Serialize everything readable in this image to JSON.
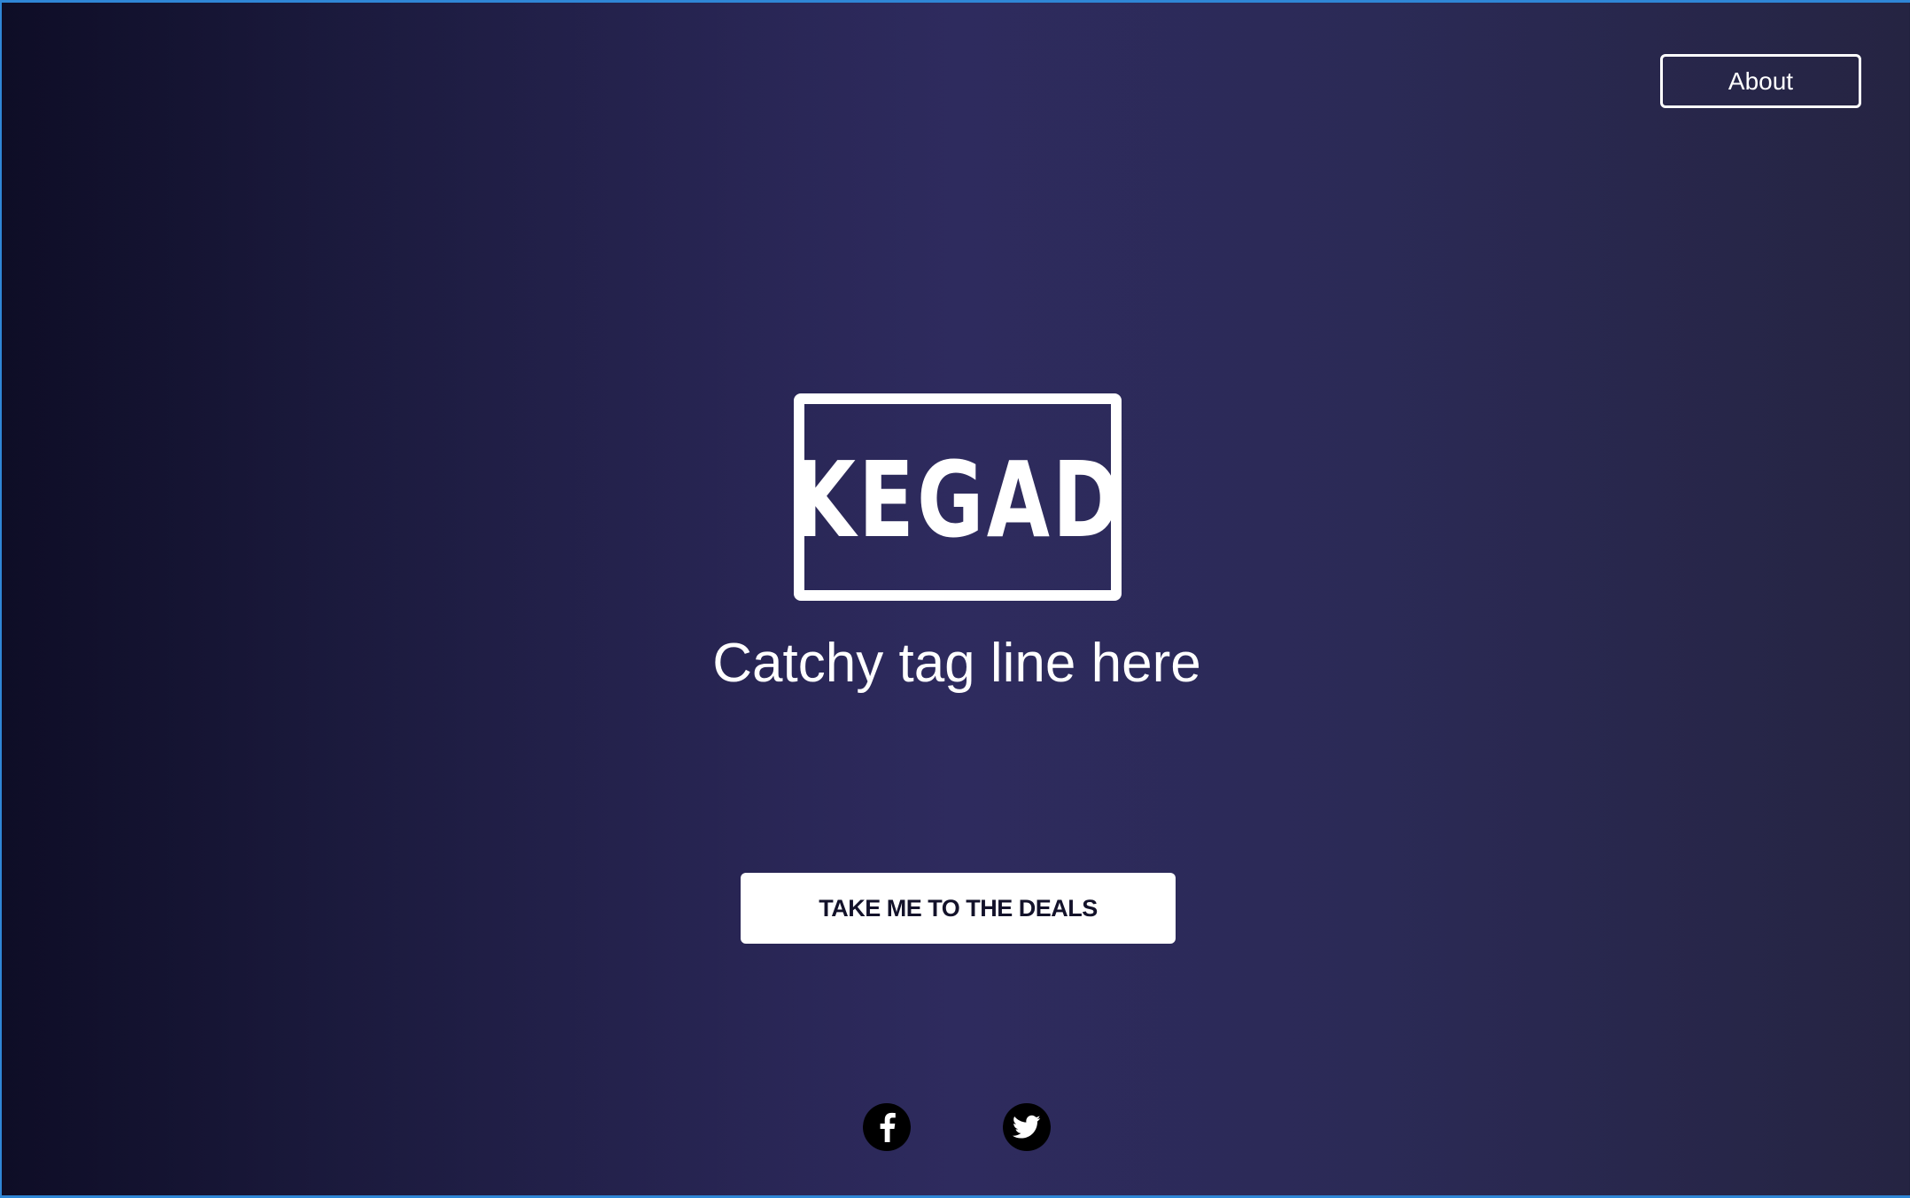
{
  "nav": {
    "about_label": "About"
  },
  "hero": {
    "logo_text": "KEGAD",
    "tagline": "Catchy tag line here",
    "cta_label": "TAKE ME TO THE DEALS"
  },
  "social": {
    "icons": [
      "facebook-icon",
      "twitter-icon"
    ]
  },
  "colors": {
    "accent_border": "#2f86d6",
    "background_mid": "#2e2b5e",
    "background_dark": "#0e0d26",
    "text": "#ffffff",
    "cta_text": "#13122a"
  }
}
